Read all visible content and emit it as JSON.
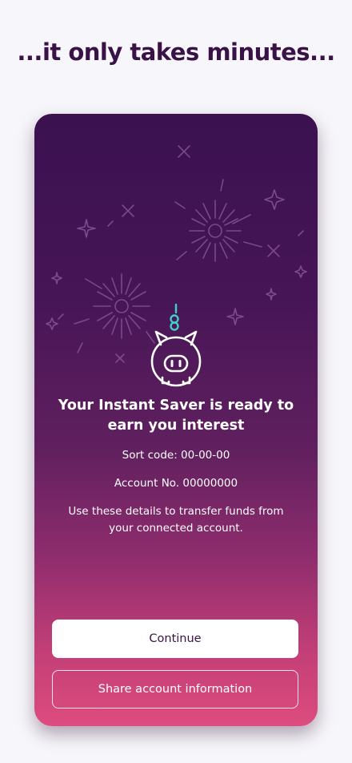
{
  "headline": "...it only takes minutes...",
  "card": {
    "title": "Your Instant Saver is ready to earn you interest",
    "sort_code": "Sort code: 00-00-00",
    "account_number": "Account No. 00000000",
    "note": "Use these details to transfer funds from your connected account.",
    "continue_label": "Continue",
    "share_label": "Share account information"
  },
  "icons": [
    "fireworks-illustration",
    "piggy-bank-icon",
    "coin-icon"
  ],
  "colors": {
    "headline": "#3a1248",
    "card_top": "#3b1150",
    "card_bottom": "#dd4c7e",
    "coin_accent": "#3fd0c4"
  }
}
